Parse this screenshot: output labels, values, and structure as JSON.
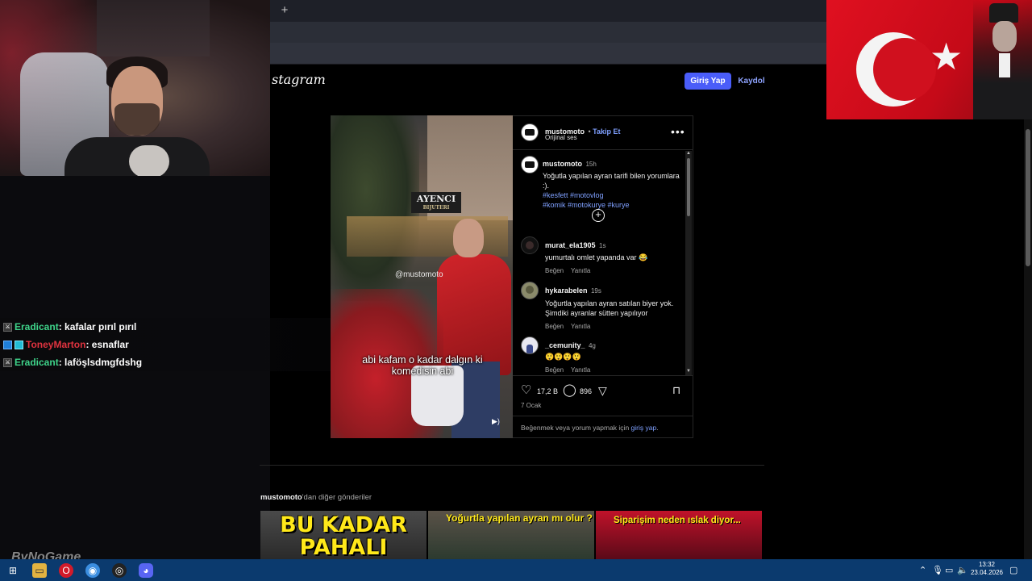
{
  "browser": {
    "new_tab": "+"
  },
  "instagram": {
    "logo": "stagram",
    "login_button": "Giriş Yap",
    "signup_button": "Kaydol"
  },
  "video": {
    "shop_sign": "AYENCI",
    "shop_sub": "BIJUTERI",
    "watermark": "@mustomoto",
    "caption": "abi kafam o kadar dalgın ki komedisin abi"
  },
  "post": {
    "author": "mustomoto",
    "follow": "Takip Et",
    "audio": "Orijinal ses",
    "caption_author": "mustomoto",
    "caption_time": "15h",
    "caption_text": "Yoğutla yapılan ayran tarifi bilen yorumlara :).",
    "caption_tags_1": "#kesfett  #motovlog",
    "caption_tags_2": "#komik  #motokurye #kurye",
    "comments": [
      {
        "user": "murat_ela1905",
        "time": "1s",
        "text": "yumurtalı omlet yapanda var 😂",
        "like": "Beğen",
        "reply": "Yanıtla"
      },
      {
        "user": "hykarabelen",
        "time": "19s",
        "text": "Yoğurtla yapılan ayran satılan biyer yok. Şimdiki ayranlar sütten yapılıyor",
        "like": "Beğen",
        "reply": "Yanıtla"
      },
      {
        "user": "_cemunity_",
        "time": "4g",
        "text": "😲😲😲😲",
        "like": "Beğen",
        "reply": "Yanıtla"
      }
    ],
    "likes": "17,2 B",
    "comment_count": "896",
    "date": "7 Ocak",
    "login_prompt": "Beğenmek veya yorum yapmak için ",
    "login_link": "giriş yap",
    "login_end": "."
  },
  "more_posts": {
    "author": "mustomoto",
    "suffix": "'dan diğer gönderiler",
    "thumbs": [
      "BU KADAR PAHALI",
      "Yoğurtla yapılan ayran mı olur ?",
      "Siparişim neden ıslak diyor..."
    ]
  },
  "chat": [
    {
      "user": "Eradicant",
      "message": ": kafalar pırıl pırıl"
    },
    {
      "user": "ToneyMarton",
      "message": ": esnaflar"
    },
    {
      "user": "Eradicant",
      "message": ": laföşlsdmgfdshg"
    }
  ],
  "stream_watermark": "ByNoGame",
  "taskbar": {
    "time": "13:32",
    "date": "23.04.2026"
  }
}
